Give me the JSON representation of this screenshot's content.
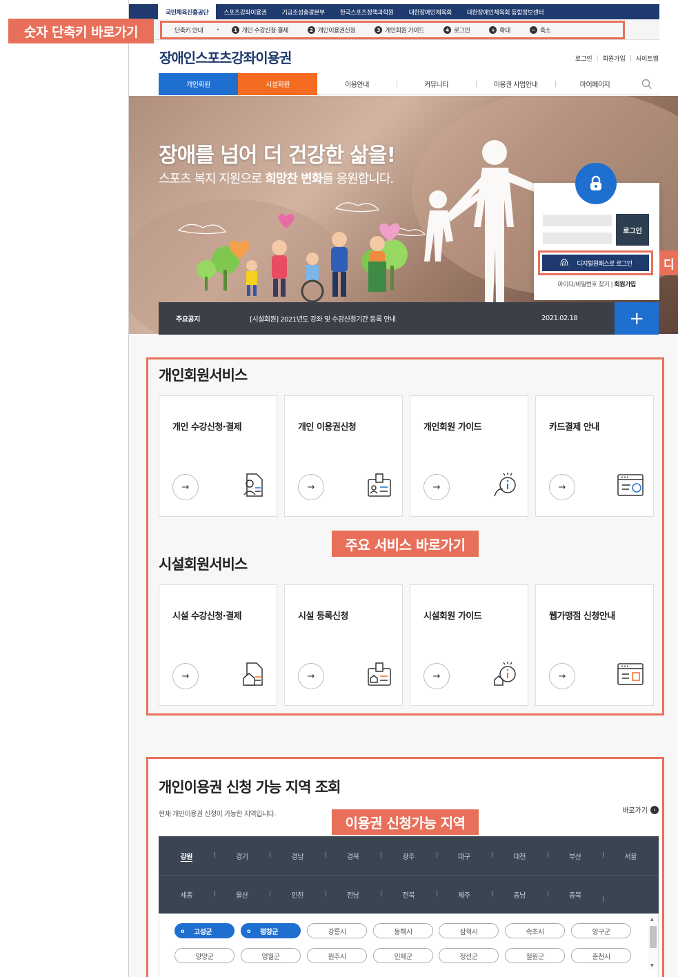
{
  "top_tabs": [
    "국민체육진흥공단",
    "스포츠강좌이용권",
    "기금조성총괄본부",
    "한국스포츠정책과학원",
    "대한장애인체육회",
    "대한장애인체육회 등합정보센터"
  ],
  "shortcut": {
    "label": "단축키 안내",
    "dot": "·",
    "items": [
      {
        "num": "1",
        "label": "개인 수강신청·결제"
      },
      {
        "num": "2",
        "label": "개인이용권신청"
      },
      {
        "num": "3",
        "label": "개인회원 가이드"
      },
      {
        "num": "4",
        "label": "로그인"
      },
      {
        "num": "+",
        "label": "확대"
      },
      {
        "num": "−",
        "label": "축소"
      }
    ]
  },
  "annotations": {
    "shortcut": "숫자 단축키 바로가기",
    "services": "주요 서비스 바로가기",
    "region": "이용권 신청가능 지역",
    "digital": "디"
  },
  "header": {
    "logo": "장애인스포츠강좌이용권",
    "util": [
      "로그인",
      "회원가입",
      "사이트맵"
    ]
  },
  "nav": [
    "개인회원",
    "시설회원",
    "이용안내",
    "커뮤니티",
    "이용권 사업안내",
    "마이페이지"
  ],
  "hero": {
    "title": "장애를 넘어 더 건강한 삶을!",
    "sub_1": "스포츠 복지 지원으로 ",
    "sub_bold": "희망찬 변화",
    "sub_2": "를 응원합니다."
  },
  "login": {
    "button": "로그인",
    "digital_button": "디지털원패스로 로그인",
    "find": "아이디/비밀번호 찾기 |",
    "join": "회원가입"
  },
  "notice": {
    "label": "주요공지",
    "text": "[시설회원] 2021년도 강좌 및 수강신청기간 등록 안내",
    "date": "2021.02.18",
    "more": "+"
  },
  "personal": {
    "title": "개인회원서비스",
    "cards": [
      "개인 수강신청·결제",
      "개인 이용권신청",
      "개인회원 가이드",
      "카드결제 안내"
    ]
  },
  "facility": {
    "title": "시설회원서비스",
    "cards": [
      "시설 수강신청·결제",
      "시설 등록신청",
      "시설회원 가이드",
      "웹가맹점 신청안내"
    ]
  },
  "region": {
    "title": "개인이용권 신청 가능 지역 조회",
    "desc": "현재 개인이용권 신청이 가능한 지역입니다.",
    "more": "바로가기",
    "row1": [
      "강원",
      "경기",
      "경남",
      "경북",
      "광주",
      "대구",
      "대전",
      "부산",
      "서울"
    ],
    "row2": [
      "세종",
      "울산",
      "인천",
      "전남",
      "전북",
      "제주",
      "충남",
      "충북"
    ],
    "selected": "강원",
    "districts_row1": [
      "고성군",
      "평창군",
      "강릉시",
      "동해시",
      "삼척시",
      "속초시",
      "양구군"
    ],
    "districts_row2": [
      "양양군",
      "영월군",
      "원주시",
      "인제군",
      "정선군",
      "철원군",
      "춘천시"
    ],
    "selected_districts": [
      "고성군",
      "평창군"
    ]
  },
  "colors": {
    "navy": "#1e3a6e",
    "blue": "#1f6fd1",
    "orange": "#f36c21",
    "annotation": "#e8705a"
  }
}
